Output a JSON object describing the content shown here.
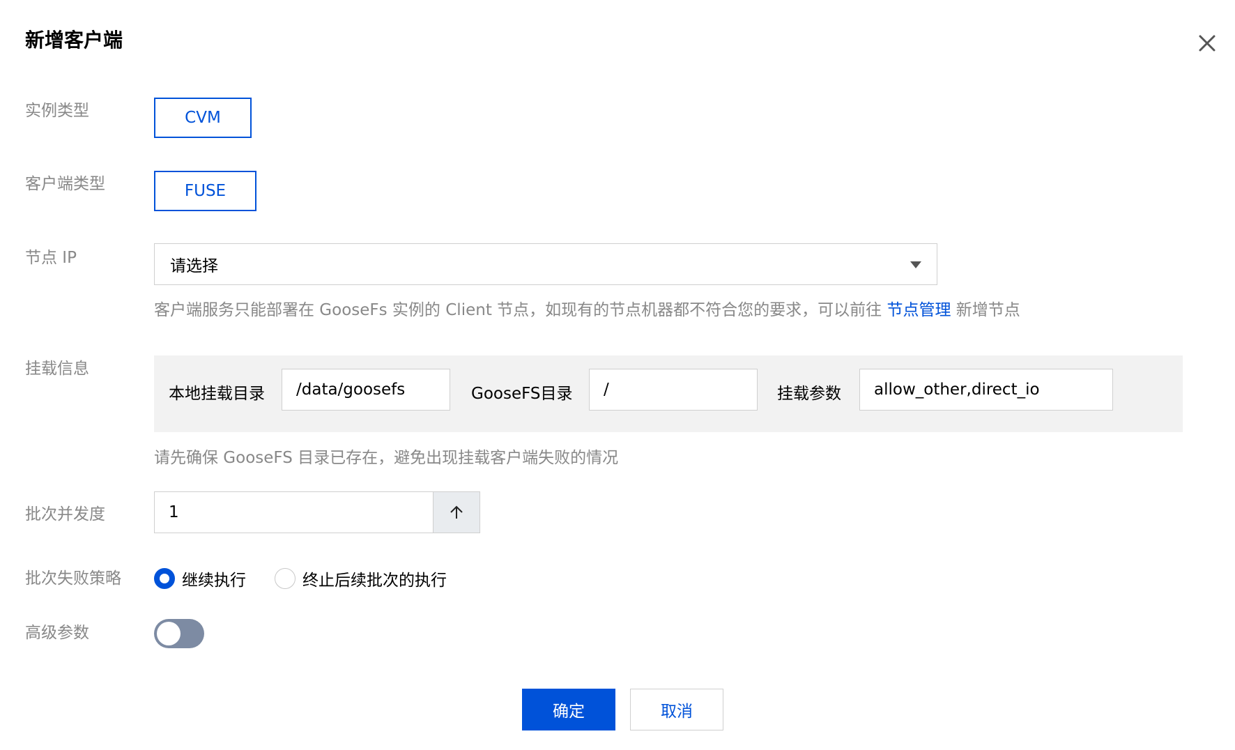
{
  "dialog": {
    "title": "新增客户端"
  },
  "form": {
    "instance_type": {
      "label": "实例类型",
      "value": "CVM"
    },
    "client_type": {
      "label": "客户端类型",
      "value": "FUSE"
    },
    "node_ip": {
      "label": "节点 IP",
      "placeholder": "请选择",
      "hint_text": "客户端服务只能部署在 GooseFs 实例的 Client 节点，如现有的节点机器都不符合您的要求，可以前往",
      "hint_link": "节点管理",
      "hint_suffix": "新增节点"
    },
    "mount": {
      "label": "挂载信息",
      "local_dir_label": "本地挂载目录",
      "local_dir_value": "/data/goosefs",
      "goosefs_dir_label": "GooseFS目录",
      "goosefs_dir_value": "/",
      "params_label": "挂载参数",
      "params_value": "allow_other,direct_io",
      "hint": "请先确保 GooseFS 目录已存在，避免出现挂载客户端失败的情况"
    },
    "batch_concurrency": {
      "label": "批次并发度",
      "value": "1"
    },
    "batch_failure_strategy": {
      "label": "批次失败策略",
      "options": [
        {
          "label": "继续执行",
          "selected": true
        },
        {
          "label": "终止后续批次的执行",
          "selected": false
        }
      ]
    },
    "advanced_params": {
      "label": "高级参数",
      "enabled": false
    }
  },
  "footer": {
    "confirm_label": "确定",
    "cancel_label": "取消"
  },
  "colors": {
    "primary": "#0052d9",
    "label": "#888888",
    "toggle_off": "#7d8ba3"
  }
}
